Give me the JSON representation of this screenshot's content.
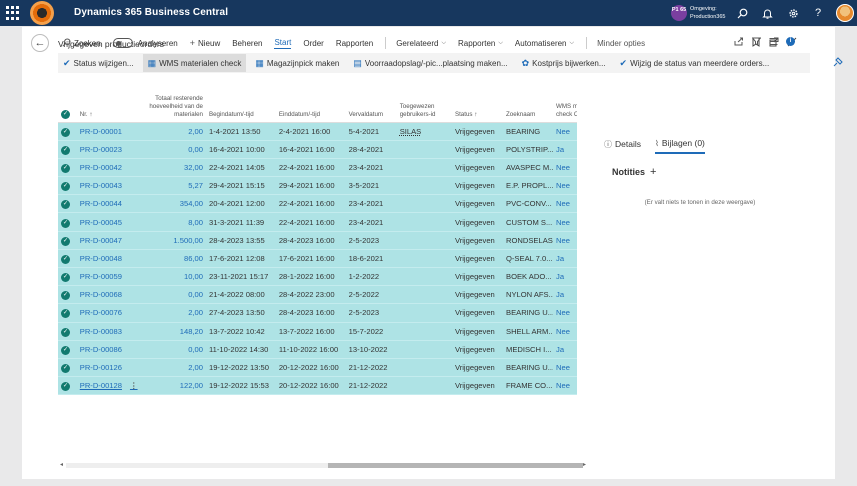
{
  "app": {
    "name": "Dynamics 365 Business Central",
    "env_badge": "P1 65",
    "env_label": "Omgeving:",
    "env_name": "Production365"
  },
  "page": {
    "title": "Vrijgegeven productieorders"
  },
  "actions": {
    "search": "Zoeken",
    "analyze": "Analyseren",
    "new": "Nieuw",
    "manage": "Beheren",
    "start": "Start",
    "order": "Order",
    "reports": "Rapporten",
    "related": "Gerelateerd",
    "reports2": "Rapporten",
    "automate": "Automatiseren",
    "fewer": "Minder opties"
  },
  "promoted": [
    "Status wijzigen...",
    "WMS materialen check",
    "Magazijnpick maken",
    "Voorraadopslag/-pic...plaatsing maken...",
    "Kostprijs bijwerken...",
    "Wijzig de status van meerdere orders..."
  ],
  "columns": {
    "no": "Nr. ↑",
    "remaining": "Totaal resterende hoeveelheid van de materialen",
    "start": "Begindatum/-tijd",
    "end": "Einddatum/-tijd",
    "due": "Vervaldatum",
    "assigned": "Toegewezen gebruikers-id",
    "status": "Status ↑",
    "searchname": "Zoeknaam",
    "wms": "WMS materi... check OK"
  },
  "rows": [
    {
      "no": "PR-D-00001",
      "qty": "2,00",
      "start": "1-4-2021 13:50",
      "end": "2-4-2021 16:00",
      "due": "5-4-2021",
      "user": "SILAS",
      "status": "Vrijgegeven",
      "name": "BEARING",
      "wms": "Nee"
    },
    {
      "no": "PR-D-00023",
      "qty": "0,00",
      "start": "16-4-2021 10:00",
      "end": "16-4-2021 16:00",
      "due": "28-4-2021",
      "user": "",
      "status": "Vrijgegeven",
      "name": "POLYSTRIP...",
      "wms": "Ja"
    },
    {
      "no": "PR-D-00042",
      "qty": "32,00",
      "start": "22-4-2021 14:05",
      "end": "22-4-2021 16:00",
      "due": "23-4-2021",
      "user": "",
      "status": "Vrijgegeven",
      "name": "AVASPEC M...",
      "wms": "Nee"
    },
    {
      "no": "PR-D-00043",
      "qty": "5,27",
      "start": "29-4-2021 15:15",
      "end": "29-4-2021 16:00",
      "due": "3-5-2021",
      "user": "",
      "status": "Vrijgegeven",
      "name": "E.P. PROPL...",
      "wms": "Nee"
    },
    {
      "no": "PR-D-00044",
      "qty": "354,00",
      "start": "20-4-2021 12:00",
      "end": "22-4-2021 16:00",
      "due": "23-4-2021",
      "user": "",
      "status": "Vrijgegeven",
      "name": "PVC-CONV...",
      "wms": "Nee"
    },
    {
      "no": "PR-D-00045",
      "qty": "8,00",
      "start": "31-3-2021 11:39",
      "end": "22-4-2021 16:00",
      "due": "23-4-2021",
      "user": "",
      "status": "Vrijgegeven",
      "name": "CUSTOM S...",
      "wms": "Nee"
    },
    {
      "no": "PR-D-00047",
      "qty": "1.500,00",
      "start": "28-4-2023 13:55",
      "end": "28-4-2023 16:00",
      "due": "2-5-2023",
      "user": "",
      "status": "Vrijgegeven",
      "name": "RONDSELAS",
      "wms": "Nee"
    },
    {
      "no": "PR-D-00048",
      "qty": "86,00",
      "start": "17-6-2021 12:08",
      "end": "17-6-2021 16:00",
      "due": "18-6-2021",
      "user": "",
      "status": "Vrijgegeven",
      "name": "Q-SEAL 7.0...",
      "wms": "Ja"
    },
    {
      "no": "PR-D-00059",
      "qty": "10,00",
      "start": "23-11-2021 15:17",
      "end": "28-1-2022 16:00",
      "due": "1-2-2022",
      "user": "",
      "status": "Vrijgegeven",
      "name": "BOEK ADO...",
      "wms": "Ja"
    },
    {
      "no": "PR-D-00068",
      "qty": "0,00",
      "start": "21-4-2022 08:00",
      "end": "28-4-2022 23:00",
      "due": "2-5-2022",
      "user": "",
      "status": "Vrijgegeven",
      "name": "NYLON AFS...",
      "wms": "Ja"
    },
    {
      "no": "PR-D-00076",
      "qty": "2,00",
      "start": "27-4-2023 13:50",
      "end": "28-4-2023 16:00",
      "due": "2-5-2023",
      "user": "",
      "status": "Vrijgegeven",
      "name": "BEARING U...",
      "wms": "Nee"
    },
    {
      "no": "PR-D-00083",
      "qty": "148,20",
      "start": "13-7-2022 10:42",
      "end": "13-7-2022 16:00",
      "due": "15-7-2022",
      "user": "",
      "status": "Vrijgegeven",
      "name": "SHELL ARM...",
      "wms": "Nee"
    },
    {
      "no": "PR-D-00086",
      "qty": "0,00",
      "start": "11-10-2022 14:30",
      "end": "11-10-2022 16:00",
      "due": "13-10-2022",
      "user": "",
      "status": "Vrijgegeven",
      "name": "MEDISCH I...",
      "wms": "Ja"
    },
    {
      "no": "PR-D-00126",
      "qty": "2,00",
      "start": "19-12-2022 13:50",
      "end": "20-12-2022 16:00",
      "due": "21-12-2022",
      "user": "",
      "status": "Vrijgegeven",
      "name": "BEARING U...",
      "wms": "Nee"
    },
    {
      "no": "PR-D-00128",
      "qty": "122,00",
      "start": "19-12-2022 15:53",
      "end": "20-12-2022 16:00",
      "due": "21-12-2022",
      "user": "",
      "status": "Vrijgegeven",
      "name": "FRAME CO...",
      "wms": "Nee",
      "current": true
    }
  ],
  "factbox": {
    "tab_details": "Details",
    "tab_attachments": "Bijlagen (0)",
    "notes_label": "Notities",
    "empty_text": "(Er valt niets te tonen in deze weergave)"
  },
  "colors": {
    "topbar": "#17375e",
    "row_selected": "#aee3e5",
    "accent": "#1e6bb8",
    "check": "#127a6f"
  }
}
